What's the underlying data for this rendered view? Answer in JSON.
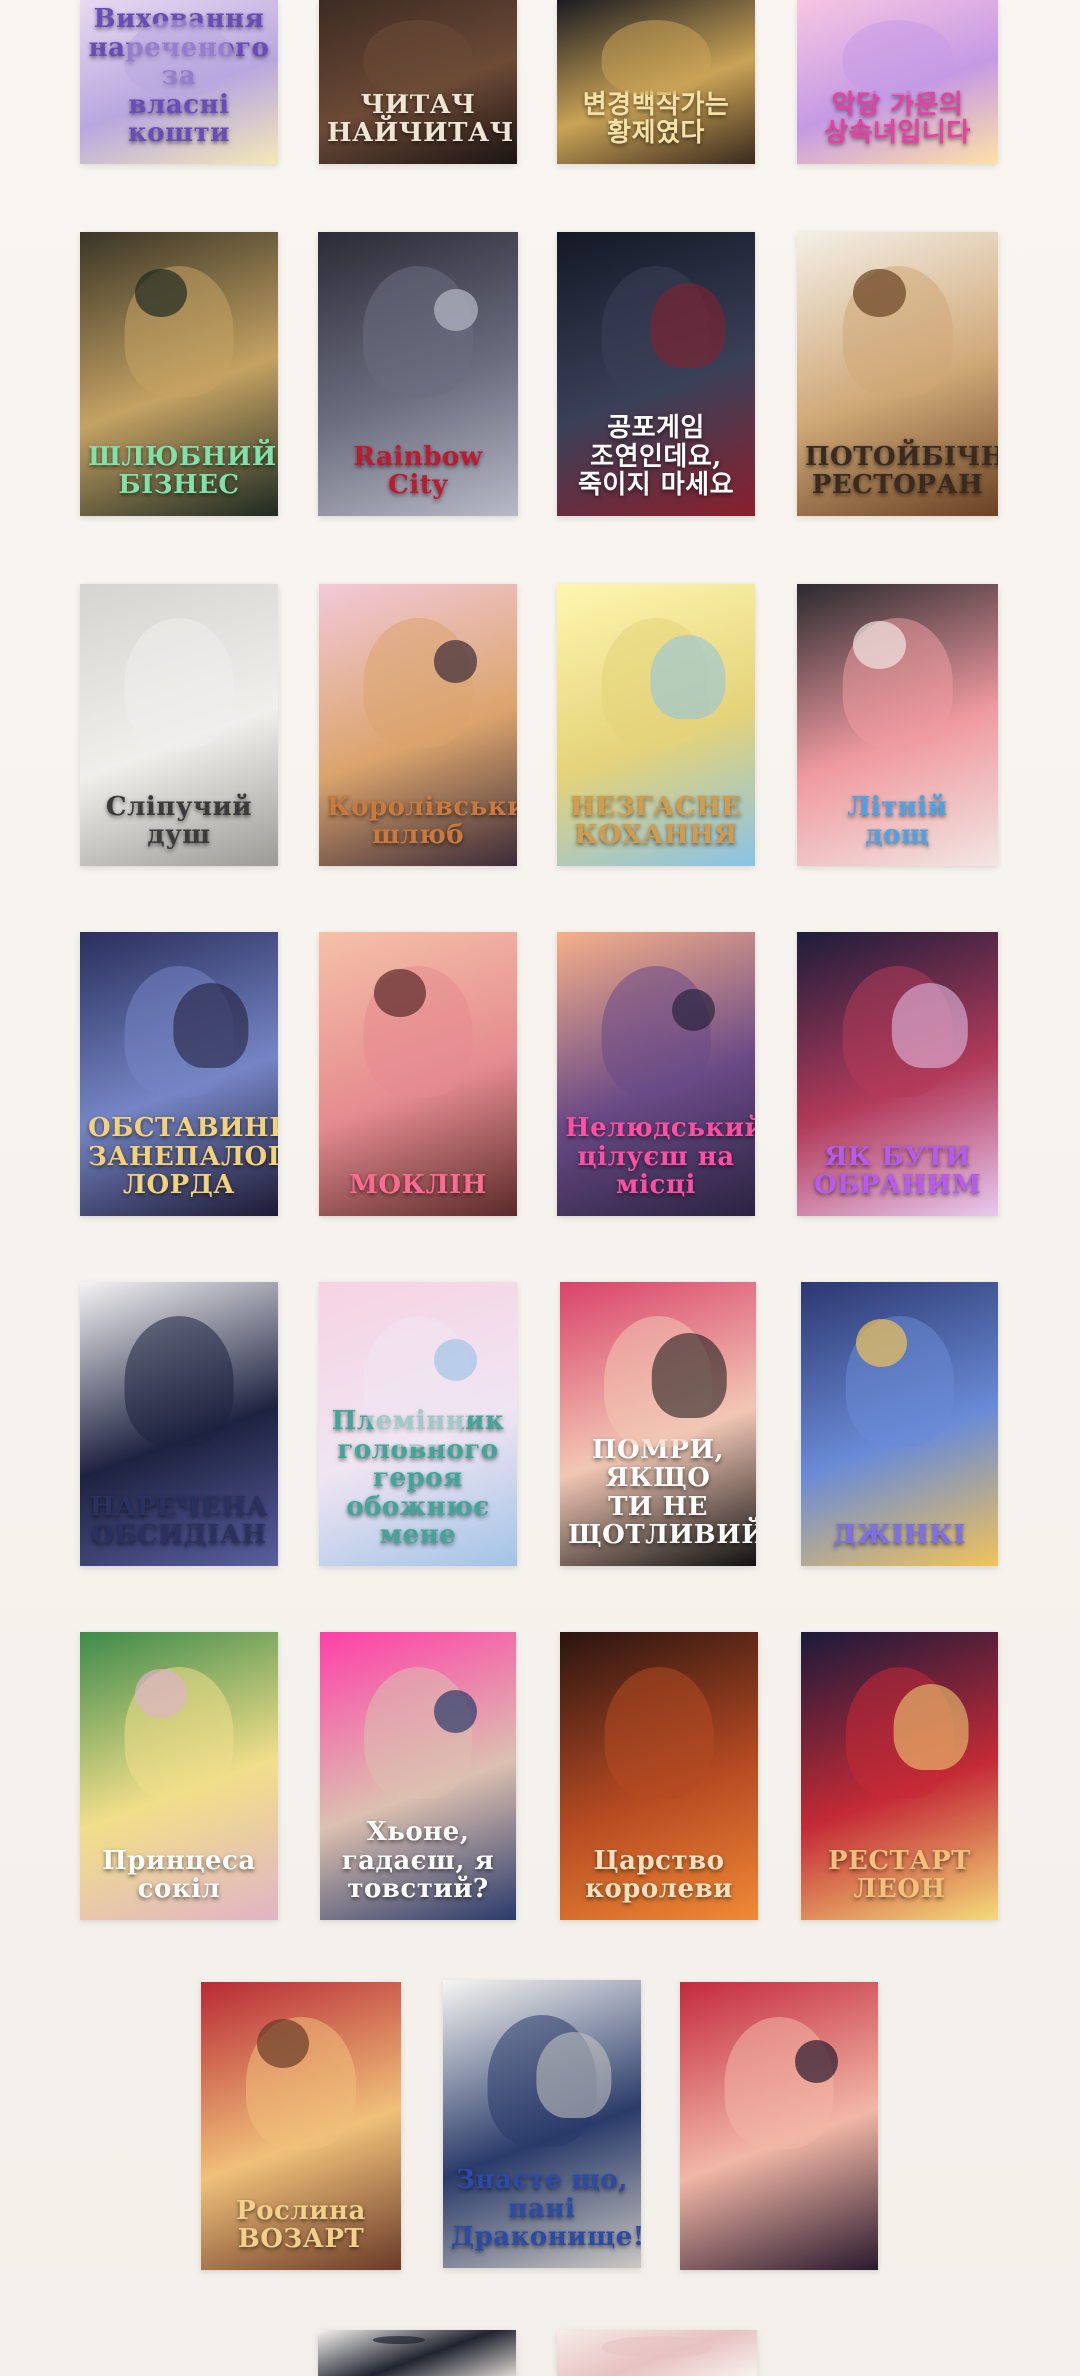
{
  "covers": [
    {
      "title": "Виховання\nнареченого за\nвласні кошти",
      "bg": [
        "#e9d9f1",
        "#b8a7df",
        "#f4e9b8"
      ],
      "text": "#6a4bbf"
    },
    {
      "title": "ЧИТАЧ\nНАЙЧИТАЧ",
      "bg": [
        "#3d2b22",
        "#6c4a36",
        "#1b1412"
      ],
      "text": "#f1e6d6"
    },
    {
      "title": "변경백작가는\n황제였다",
      "bg": [
        "#1b1b22",
        "#c9a356",
        "#3a2a1f"
      ],
      "text": "#f6e1a6"
    },
    {
      "title": "악당 가문의\n상속녀입니다",
      "bg": [
        "#f7c6e2",
        "#c59ae5",
        "#ffe1a6"
      ],
      "text": "#e93fa5"
    },
    {
      "title": "ШЛЮБНИЙ\nБІЗНЕС",
      "bg": [
        "#3a3526",
        "#c4a263",
        "#1e2a22"
      ],
      "text": "#7fe2a8"
    },
    {
      "title": "Rainbow City",
      "bg": [
        "#2b2a36",
        "#6c6e80",
        "#b7b9c6"
      ],
      "text": "#c2182f"
    },
    {
      "title": "공포게임\n조연인데요,\n죽이지 마세요",
      "bg": [
        "#141826",
        "#3a4058",
        "#8a1f2c"
      ],
      "text": "#ffffff"
    },
    {
      "title": "ПОТОЙБІЧНИЙ\nРЕСТОРАН",
      "bg": [
        "#f4efe6",
        "#cfa877",
        "#6a4224"
      ],
      "text": "#3a2a20"
    },
    {
      "title": "Сліпучий\nдуш",
      "bg": [
        "#d6d4d0",
        "#f0efec",
        "#9c9a95"
      ],
      "text": "#3a3a3a"
    },
    {
      "title": "Королівський\nшлюб",
      "bg": [
        "#f2c9d8",
        "#dba46d",
        "#3b2b38"
      ],
      "text": "#c97a3c"
    },
    {
      "title": "НЕЗГАСНЕ\nКОХАННЯ",
      "bg": [
        "#fff6b0",
        "#e4d37a",
        "#8ac2e6"
      ],
      "text": "#d49b4a"
    },
    {
      "title": "Літній\nдощ",
      "bg": [
        "#2a2a2e",
        "#ef9aa0",
        "#f2e6e2"
      ],
      "text": "#4aa3e8"
    },
    {
      "title": "ОБСТАВИНИ\nЗАНЕПАЛОГО\nЛОРДА",
      "bg": [
        "#2a2f5c",
        "#7585c5",
        "#1d1a33"
      ],
      "text": "#f3d27a"
    },
    {
      "title": "МОКЛІН",
      "bg": [
        "#f5c1a8",
        "#e58b8f",
        "#5a2a2a"
      ],
      "text": "#ff6a8e"
    },
    {
      "title": "Нелюдський\nцілуєш на місці",
      "bg": [
        "#f6b08a",
        "#6a4a86",
        "#2a2340"
      ],
      "text": "#ff4fa5"
    },
    {
      "title": "ЯК БУТИ\nОБРАНИМ",
      "bg": [
        "#1c1d3a",
        "#b23a5a",
        "#e8c9ef"
      ],
      "text": "#b75af0"
    },
    {
      "title": "НАРЕЧЕНА\nОБСИДІАН",
      "bg": [
        "#f4f3f4",
        "#1d2240",
        "#5a5fa0"
      ],
      "text": "#2a3160"
    },
    {
      "title": "Племінник\nголовного героя\nобожнює мене",
      "bg": [
        "#f7d3e2",
        "#f0e5f3",
        "#a2c4e6"
      ],
      "text": "#3fa79a"
    },
    {
      "title": "ПОМРИ,\nЯКЩО\nТИ НЕ\nЩОТЛИВИЙ",
      "bg": [
        "#d9436a",
        "#f2c7b5",
        "#111111"
      ],
      "text": "#ffffff"
    },
    {
      "title": "ДЖІНКІ",
      "bg": [
        "#2c3870",
        "#6a8bd6",
        "#f1c35a"
      ],
      "text": "#7d6ef0"
    },
    {
      "title": "Принцеса\nсокіл",
      "bg": [
        "#3e8a4a",
        "#f1df8a",
        "#e0b4c6"
      ],
      "text": "#ffffff"
    },
    {
      "title": "Хьоне,\nгадаєш, я\nтовстий?",
      "bg": [
        "#ff3fa8",
        "#dcc0b0",
        "#2a3a6a"
      ],
      "text": "#ffffff"
    },
    {
      "title": "Царство\nкоролеви",
      "bg": [
        "#2a1410",
        "#b54a22",
        "#f08a35"
      ],
      "text": "#ffe0c0"
    },
    {
      "title": "РЕСТАРТ\nЛЕОН",
      "bg": [
        "#1a1a3a",
        "#c42a36",
        "#f5da7a"
      ],
      "text": "#f5c07a"
    },
    {
      "title": "Рослина\nВОЗАРТ",
      "bg": [
        "#b82a35",
        "#f0c07a",
        "#6a3a28"
      ],
      "text": "#f4d08a"
    },
    {
      "title": "Знаєте що,\nпані Драконище!",
      "bg": [
        "#f6f6f2",
        "#2a3b6a",
        "#cbc8c2"
      ],
      "text": "#2c4aa8"
    },
    {
      "title": "",
      "bg": [
        "#c42a3e",
        "#f2b7a6",
        "#2a1a2e"
      ],
      "text": "#ffffff"
    },
    {
      "title": "",
      "bg": [
        "#f6f3ef",
        "#1f2430",
        "#dcd6cf"
      ],
      "text": "#222222"
    },
    {
      "title": "",
      "bg": [
        "#f6ece8",
        "#e7c2c2",
        "#f7f1ec"
      ],
      "text": "#c08090"
    }
  ]
}
